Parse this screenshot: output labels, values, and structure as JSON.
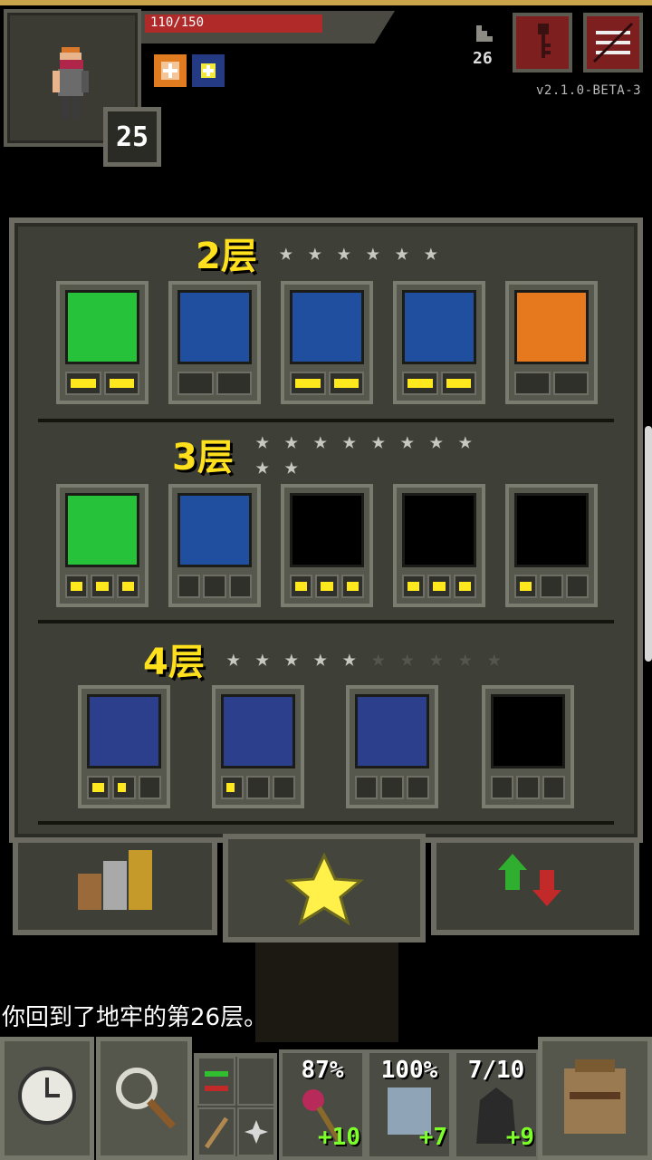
{
  "status": {
    "hp_text": "110/150",
    "hp_fraction": 0.733,
    "hero_level": "25",
    "depth": "26",
    "version": "v2.1.0-BETA-3"
  },
  "talents": {
    "tier2_label": "2层",
    "tier3_label": "3层",
    "tier4_label": "4层",
    "tier2": [
      {
        "icon": "shield-recharge-icon",
        "color": "#25c23a",
        "points": [
          1,
          1
        ]
      },
      {
        "icon": "battery-icon",
        "color": "#1f4f9e",
        "points": [
          0,
          0
        ]
      },
      {
        "icon": "grid-icon",
        "color": "#1f4f9e",
        "points": [
          1,
          1
        ]
      },
      {
        "icon": "sleep-skull-icon",
        "color": "#1f4f9e",
        "points": [
          1,
          1
        ]
      },
      {
        "icon": "eye-icon",
        "color": "#e6781e",
        "points": [
          0,
          0
        ]
      }
    ],
    "tier3": [
      {
        "icon": "shield-up-icon",
        "color": "#25c23a",
        "points": [
          1,
          1,
          1
        ]
      },
      {
        "icon": "ghost-icon",
        "color": "#1f4f9e",
        "points": [
          0,
          0,
          0
        ]
      },
      {
        "icon": "slash-skull-icon",
        "color": "#000000",
        "points": [
          1,
          1,
          1
        ]
      },
      {
        "icon": "slash-arrow-icon",
        "color": "#000000",
        "points": [
          1,
          1,
          1
        ]
      },
      {
        "icon": "slash-coin-icon",
        "color": "#000000",
        "points": [
          1,
          0,
          0
        ]
      }
    ],
    "tier4": [
      {
        "icon": "eye-runner-icon",
        "color": "#2b3f8c",
        "points": [
          "on",
          "half",
          "off"
        ]
      },
      {
        "icon": "eye-shield-icon",
        "color": "#2b3f8c",
        "points": [
          "half",
          "off",
          "off"
        ]
      },
      {
        "icon": "eye-figure-icon",
        "color": "#2b3f8c",
        "points": [
          "off",
          "off",
          "off"
        ]
      },
      {
        "icon": "armor-icon",
        "color": "#000000",
        "points": [
          "off",
          "off",
          "off"
        ]
      }
    ],
    "tier2_stars": {
      "lit": 6,
      "dim": 0
    },
    "tier3_stars": {
      "lit": 10,
      "dim": 0
    },
    "tier4_stars": {
      "lit": 5,
      "dim": 5
    }
  },
  "tabs": [
    "stats-tab",
    "talents-tab",
    "upgrades-tab"
  ],
  "log_message": "你回到了地牢的第26层。",
  "equipment": [
    {
      "pct": "87%",
      "bonus": "+10"
    },
    {
      "pct": "100%",
      "bonus": "+7"
    },
    {
      "pct": "7/10",
      "bonus": "+9"
    }
  ]
}
